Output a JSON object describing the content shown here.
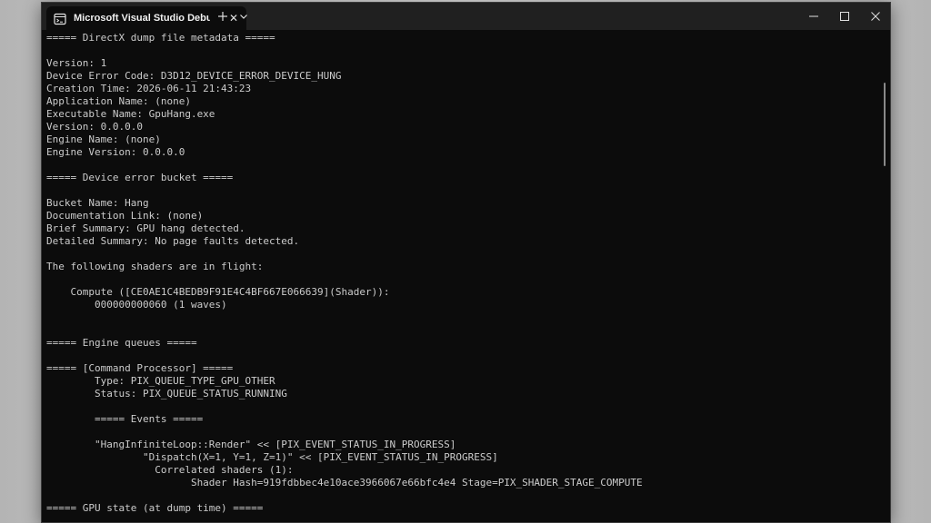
{
  "window": {
    "tab_title": "Microsoft Visual Studio Debu",
    "tab_close_glyph": "✕",
    "icons": {
      "tab": "terminal-icon",
      "new_tab": "plus-icon",
      "dropdown": "chevron-down-icon",
      "minimize": "minimize-icon",
      "maximize": "maximize-icon",
      "close": "close-icon"
    }
  },
  "console": {
    "lines": [
      "===== DirectX dump file metadata =====",
      "",
      "Version: 1",
      "Device Error Code: D3D12_DEVICE_ERROR_DEVICE_HUNG",
      "Creation Time: 2026-06-11 21:43:23",
      "Application Name: (none)",
      "Executable Name: GpuHang.exe",
      "Version: 0.0.0.0",
      "Engine Name: (none)",
      "Engine Version: 0.0.0.0",
      "",
      "===== Device error bucket =====",
      "",
      "Bucket Name: Hang",
      "Documentation Link: (none)",
      "Brief Summary: GPU hang detected.",
      "Detailed Summary: No page faults detected.",
      "",
      "The following shaders are in flight:",
      "",
      "    Compute ([CE0AE1C4BEDB9F91E4C4BF667E066639](Shader)):",
      "        000000000060 (1 waves)",
      "",
      "",
      "===== Engine queues =====",
      "",
      "===== [Command Processor] =====",
      "        Type: PIX_QUEUE_TYPE_GPU_OTHER",
      "        Status: PIX_QUEUE_STATUS_RUNNING",
      "",
      "        ===== Events =====",
      "",
      "        \"HangInfiniteLoop::Render\" << [PIX_EVENT_STATUS_IN_PROGRESS]",
      "                \"Dispatch(X=1, Y=1, Z=1)\" << [PIX_EVENT_STATUS_IN_PROGRESS]",
      "                  Correlated shaders (1):",
      "                        Shader Hash=919fdbbec4e10ace3966067e66bfc4e4 Stage=PIX_SHADER_STAGE_COMPUTE",
      "",
      "===== GPU state (at dump time) ====="
    ]
  }
}
